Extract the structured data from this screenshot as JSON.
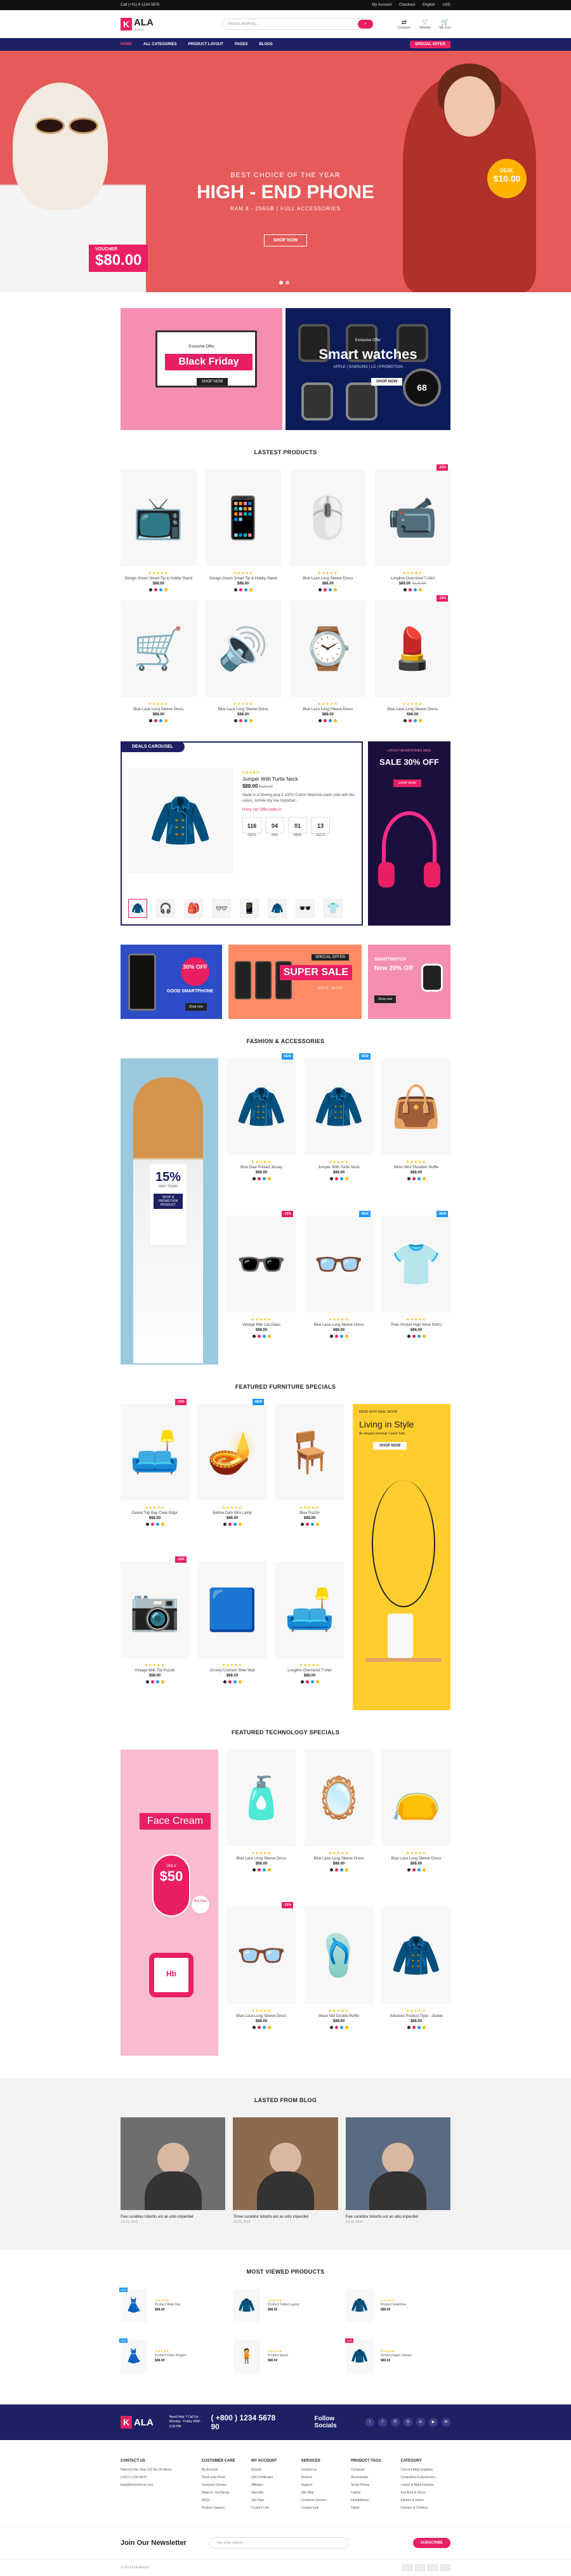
{
  "topbar": {
    "phone": "Call (+01) 6 1234 5678",
    "links": [
      "My Account",
      "Checkout",
      "English",
      "USD"
    ]
  },
  "header": {
    "logo_letter": "K",
    "logo_text": "ALA",
    "logo_sub": "MARKET",
    "search_placeholder": "Search anything...",
    "icons": [
      {
        "label": "Compare",
        "icon": "compare-icon"
      },
      {
        "label": "Wishlist",
        "icon": "heart-icon"
      },
      {
        "label": "My Cart",
        "icon": "cart-icon"
      }
    ]
  },
  "nav": {
    "items": [
      "HOME",
      "ALL CATEGORIES",
      "PRODUCT LAYOUT",
      "PAGES",
      "BLOGS"
    ],
    "offer": "SPECIAL OFFER"
  },
  "hero": {
    "line1": "BEST CHOICE OF THE YEAR",
    "line2": "HIGH - END PHONE",
    "line3": "RAM 8 - 256GB | FULL ACCESSORIES",
    "shop": "SHOP NOW",
    "voucher_label": "VOUCHER",
    "voucher_value": "$80.00",
    "deal_label": "DEAL",
    "deal_value": "$10.00"
  },
  "banners": {
    "bf_small": "Exclusive Offer",
    "bf_title": "Black Friday",
    "bf_btn": "SHOP NOW",
    "sw_small": "Exclusive Offer",
    "sw_title": "Smart watches",
    "sw_sub": "APPLE | SAMSUNG | LG | PROMOTION",
    "sw_btn": "SHOP NOW",
    "sw_num": "68"
  },
  "latest": {
    "title": "LASTEST PRODUCTS",
    "items": [
      {
        "name": "Design Green Smart Tip & Hobby Stand",
        "price": "$88.00",
        "old": "",
        "badge": "",
        "emoji": "📺",
        "bg": "#f7f7f7"
      },
      {
        "name": "Design Green Smart Tip & Hobby Stand",
        "price": "$88.00",
        "old": "",
        "badge": "",
        "emoji": "📱",
        "bg": "#f7f7f7"
      },
      {
        "name": "Blue Lace Long Sleeve Dress",
        "price": "$88.00",
        "old": "",
        "badge": "",
        "emoji": "🖱️",
        "bg": "#f7f7f7"
      },
      {
        "name": "Longline Oversized T-shirt",
        "price": "$88.00",
        "old": "$120.00",
        "badge": "-15%",
        "emoji": "📹",
        "bg": "#f7f7f7"
      },
      {
        "name": "Blue Lace Long Sleeve Dress",
        "price": "$88.00",
        "old": "",
        "badge": "",
        "emoji": "🛒",
        "bg": "#f7f7f7"
      },
      {
        "name": "Blue Lace Long Sleeve Dress",
        "price": "$88.00",
        "old": "",
        "badge": "",
        "emoji": "🔊",
        "bg": "#f7f7f7"
      },
      {
        "name": "Blue Lace Long Sleeve Dress",
        "price": "$88.00",
        "old": "",
        "badge": "",
        "emoji": "⌚",
        "bg": "#f7f7f7"
      },
      {
        "name": "Blue Lace Long Sleeve Dress",
        "price": "$88.00",
        "old": "",
        "badge": "-15%",
        "emoji": "💄",
        "bg": "#f7f7f7"
      }
    ]
  },
  "deals": {
    "header": "DEALS CAROUSEL",
    "stars": "★★★★★",
    "name": "Jumper With Turtle Neck",
    "price": "$88.00",
    "old": "$120.00",
    "desc": "Made in a flowing jacq-2 100% Cotton Machine-wash cold with like colors, tumble dry low Imported...",
    "hurry": "Hurry Up! Offer ends in",
    "countdown": [
      {
        "v": "116",
        "l": "DAYS"
      },
      {
        "v": "04",
        "l": "HRS"
      },
      {
        "v": "01",
        "l": "MINS"
      },
      {
        "v": "13",
        "l": "SECS"
      }
    ],
    "thumbs": [
      "🧥",
      "🎧",
      "🎒",
      "👓",
      "📱",
      "🧥",
      "🕶️",
      "👕"
    ],
    "side_small": "LATEST HEADPHONES SALE",
    "side_title": "SALE 30% OFF",
    "side_btn": "SHOP NOW"
  },
  "promo3": {
    "b1_circle": "30% OFF",
    "b1_text": "GOOD SMARTPHONE",
    "b1_btn": "Shop now",
    "b2_tag": "SPECIAL OFFER",
    "b2_title": "SUPER SALE",
    "b2_date": "NOV 11 - NOV 29",
    "b3_small": "SMARTWATCH",
    "b3_title": "New 20% Off",
    "b3_btn": "Shop now"
  },
  "fashion": {
    "title": "FASHION & ACCESSORIES",
    "side_pct": "15%",
    "side_cat": "ONLY TODAY",
    "side_btn": "SHOP & PROMOTION PRODUCT",
    "items": [
      {
        "name": "Bow Dual Printed Jersey",
        "price": "$88.00",
        "old": "",
        "badge": "NEW",
        "emoji": "🧥"
      },
      {
        "name": "Jumper With Turtle Neck",
        "price": "$88.00",
        "old": "",
        "badge": "NEW",
        "emoji": "🧥"
      },
      {
        "name": "Mimo Mini Shoulder Ruffle",
        "price": "$88.00",
        "old": "",
        "badge": "",
        "emoji": "👜"
      },
      {
        "name": "Vintage Milk Cat Glass",
        "price": "$88.00",
        "old": "",
        "badge": "-15%",
        "emoji": "🕶️"
      },
      {
        "name": "Blue Lace Long Sleeve Dress",
        "price": "$88.00",
        "old": "",
        "badge": "NEW",
        "emoji": "👓"
      },
      {
        "name": "Plain Pocket High Neck Shirts",
        "price": "$88.00",
        "old": "",
        "badge": "NEW",
        "emoji": "👕"
      }
    ]
  },
  "furniture": {
    "title": "FEATURED FURNITURE SPECIALS",
    "side_small": "MADE WITH REAL WOOD",
    "side_title": "Living in Style",
    "side_sub": "An elegant armchair Couch Sofa",
    "side_btn": "SHOP NOW",
    "items": [
      {
        "name": "Eased Top Bay Clear Edge",
        "price": "$88.00",
        "old": "",
        "badge": "-15%",
        "emoji": "🛋️"
      },
      {
        "name": "Bellow Dark Mini Lamp",
        "price": "$88.00",
        "old": "",
        "badge": "NEW",
        "emoji": "🪔"
      },
      {
        "name": "Blue Puzzle",
        "price": "$88.00",
        "old": "",
        "badge": "",
        "emoji": "🪑"
      },
      {
        "name": "Vintage Milk Toy Puzzle",
        "price": "$88.00",
        "old": "",
        "badge": "-15%",
        "emoji": "📷"
      },
      {
        "name": "Groovy Cushion Slow Wall",
        "price": "$88.00",
        "old": "",
        "badge": "",
        "emoji": "🟦"
      },
      {
        "name": "Longline Oversized T-shirt",
        "price": "$88.00",
        "old": "",
        "badge": "",
        "emoji": "🛋️"
      }
    ]
  },
  "tech": {
    "title": "FEATURED TECHNOLOGY SPECIALS",
    "side_title": "Face Cream",
    "side_only": "ONLY",
    "side_price": "$50",
    "side_buy": "Buy Now",
    "side_jar": "Hb",
    "items": [
      {
        "name": "Blue Lace Long Sleeve Dress",
        "price": "$88.00",
        "old": "",
        "badge": "",
        "emoji": "🧴"
      },
      {
        "name": "Blue Lace Long Sleeve Dress",
        "price": "$88.00",
        "old": "",
        "badge": "",
        "emoji": "🪞"
      },
      {
        "name": "Blue Lace Long Sleeve Dress",
        "price": "$88.00",
        "old": "",
        "badge": "",
        "emoji": "👝"
      },
      {
        "name": "Blue Lace Long Sleeve Dress",
        "price": "$88.00",
        "old": "",
        "badge": "-15%",
        "emoji": "👓"
      },
      {
        "name": "Wave Net Double Ruffle",
        "price": "$88.00",
        "old": "",
        "badge": "",
        "emoji": "🩴"
      },
      {
        "name": "Advance Product Type - Jacket",
        "price": "$88.00",
        "old": "",
        "badge": "",
        "emoji": "🧥"
      }
    ]
  },
  "blog": {
    "title": "LASTED FROM BLOG",
    "posts": [
      {
        "caption": "Fwe curabitur lobortis est an odio imperdiet",
        "date": "Jul 29, 2019",
        "bg": "#6e6e6e"
      },
      {
        "caption": "Three curabitur lobortis est an odio imperdiet",
        "date": "Jul 29, 2019",
        "bg": "#8c6a4e"
      },
      {
        "caption": "Fwe curabitur lobortis est an odio imperdiet",
        "date": "Jul 29, 2019",
        "bg": "#5a6a80"
      }
    ]
  },
  "most": {
    "title": "MOST VIEWED PRODUCTS",
    "items": [
      {
        "name": "Product Wide Day",
        "price": "$88.00",
        "badge": "NEW",
        "emoji": "👗"
      },
      {
        "name": "Product Tabled Layout",
        "price": "$88.00",
        "badge": "",
        "emoji": "🧥"
      },
      {
        "name": "Product Swatches",
        "price": "$88.00",
        "badge": "",
        "emoji": "🧥"
      },
      {
        "name": "Product Video Images",
        "price": "$88.00",
        "badge": "NEW",
        "emoji": "👗"
      },
      {
        "name": "Product layout",
        "price": "$88.00",
        "badge": "",
        "emoji": "🧍"
      },
      {
        "name": "Group Images Variant",
        "price": "$88.00",
        "badge": "-15%",
        "emoji": "🧥"
      }
    ]
  },
  "footer": {
    "need": "Need Help ? Call Us:",
    "hours": "Monday - Friday 9AM - 9:30 PM",
    "phone": "( +800 ) 1234 5678 90",
    "follow": "Follow Socials",
    "socials": [
      "t",
      "f",
      "P",
      "G",
      "in",
      "▶",
      "✉"
    ],
    "cols": [
      {
        "h": "CONTACT US",
        "items": [
          "Hanover Bus Stop 123 No.1A Street",
          "(+01) 6 1234 5678",
          "kala@themeforest.com"
        ]
      },
      {
        "h": "CUSTOMER CARE",
        "items": [
          "My Account",
          "Track your Order",
          "Customer Service",
          "Returns / Exchange",
          "FAQs",
          "Product Support"
        ]
      },
      {
        "h": "MY ACCOUNT",
        "items": [
          "Brands",
          "Gift Certificates",
          "Affiliates",
          "Specials",
          "Site Map",
          "Custom Link"
        ]
      },
      {
        "h": "SERVICES",
        "items": [
          "Contact Us",
          "Returns",
          "Support",
          "Site Map",
          "Customer Service",
          "Custom Link"
        ]
      },
      {
        "h": "PRODUCT TAGS",
        "items": [
          "Computer",
          "Accessories",
          "Smart Phone",
          "Laptop",
          "Headphones",
          "Tablet"
        ]
      },
      {
        "h": "CATEGORY",
        "items": [
          "Cool & Fitting Supplies",
          "Computers & Electronics",
          "Lamps & Night Fixtures",
          "Furniture & Decor",
          "Kitchen & Home",
          "Fashion & Clothing"
        ]
      }
    ]
  },
  "newsletter": {
    "title": "Join Our Newsletter",
    "placeholder": "Your email address",
    "btn": "SUBSCRIBE"
  },
  "copyright": "© 2019 Kala Market"
}
